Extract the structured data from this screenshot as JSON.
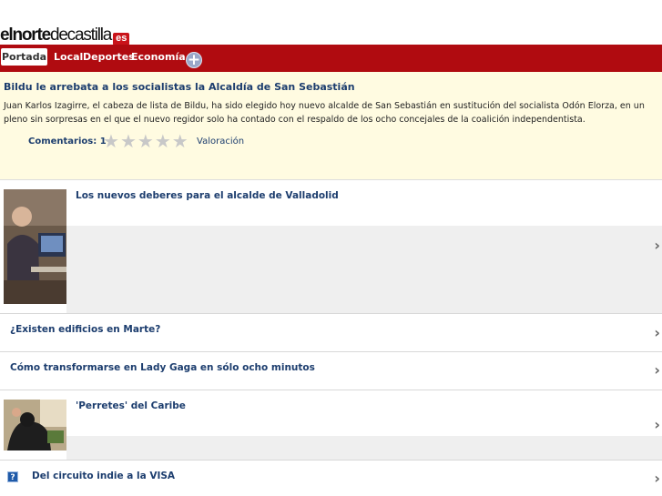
{
  "logo": {
    "part1": "elnorte",
    "part2": "decastilla",
    "badge": "es"
  },
  "nav": {
    "items": [
      "Portada",
      "Local",
      "Deportes",
      "Economía"
    ],
    "active": "Portada",
    "more_icon": "plus-circle-icon"
  },
  "featured": {
    "title": "Bildu le arrebata a los socialistas la Alcaldía de San Sebastián",
    "body": "Juan Karlos Izagirre, el cabeza de lista de Bildu, ha sido elegido hoy nuevo alcalde de San Sebastián en sustitución del socialista Odón Elorza, en un pleno sin sorpresas en el que el nuevo regidor solo ha contado con el respaldo de los ocho concejales de la coalición independentista.",
    "comments_label": "Comentarios: 1",
    "rating_stars": 5,
    "rating_value": 0,
    "rating_label": "Valoración"
  },
  "articles": [
    {
      "title": "Los nuevos deberes para el alcalde de Valladolid",
      "has_image": true
    },
    {
      "title": "¿Existen edificios en Marte?",
      "has_image": false
    },
    {
      "title": "Cómo transformarse en Lady Gaga en sólo ocho minutos",
      "has_image": false
    },
    {
      "title": "'Perretes' del Caribe",
      "has_image": true
    },
    {
      "title": "Del circuito indie a la VISA",
      "has_image": false,
      "icon": "question-icon",
      "icon_glyph": "?"
    }
  ],
  "colors": {
    "nav_red": "#b00b10",
    "link_blue": "#1c3d6e",
    "featured_bg": "#fffbe1"
  }
}
